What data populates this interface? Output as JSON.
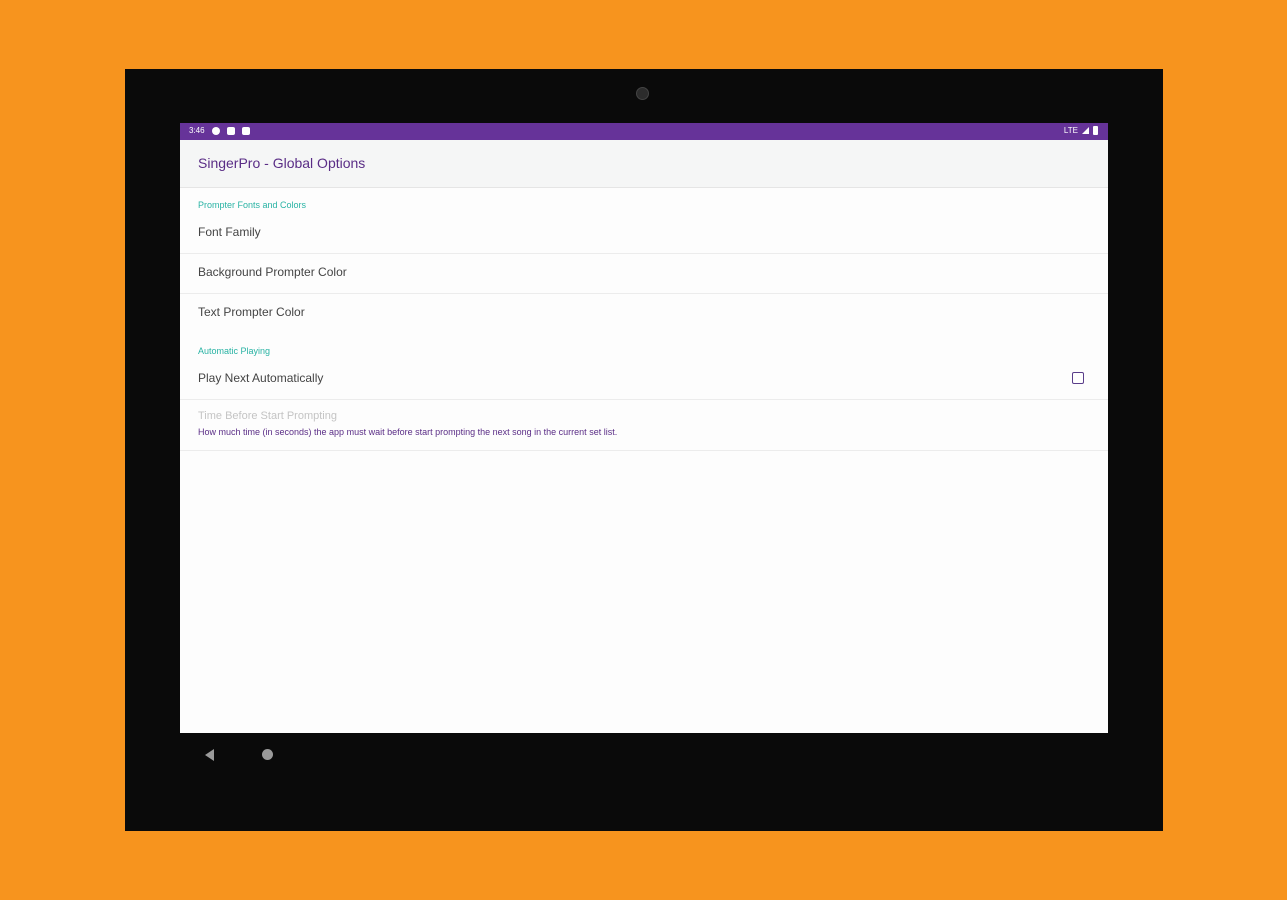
{
  "status_bar": {
    "time": "3:46",
    "network": "LTE",
    "icons": [
      "settings-notification-icon",
      "sim-icon",
      "sd-card-icon",
      "signal-icon",
      "battery-icon"
    ]
  },
  "app_bar": {
    "title": "SingerPro - Global Options"
  },
  "sections": {
    "prompter_fonts": {
      "header": "Prompter Fonts and Colors"
    },
    "automatic_playing": {
      "header": "Automatic Playing"
    }
  },
  "prefs": {
    "font_family": {
      "title": "Font Family"
    },
    "background_color": {
      "title": "Background Prompter Color"
    },
    "text_color": {
      "title": "Text Prompter Color"
    },
    "play_next": {
      "title": "Play Next Automatically",
      "checked": false
    },
    "time_before": {
      "title": "Time Before Start Prompting",
      "summary": "How much time (in seconds) the app must wait before start prompting the next song in the current set list.",
      "enabled": false
    }
  },
  "colors": {
    "background": "#F7941E",
    "status_bar": "#663399",
    "accent_teal": "#29B3A4",
    "title_purple": "#5A2D86"
  }
}
